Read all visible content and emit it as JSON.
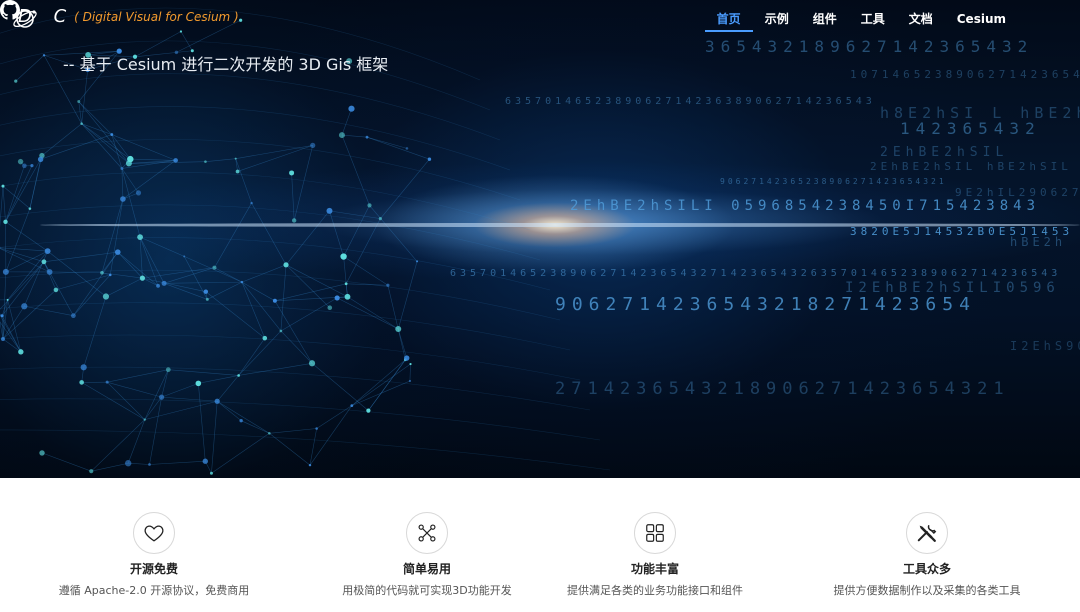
{
  "logo": {
    "text": "D C",
    "subtitle": "( Digital Visual for Cesium )"
  },
  "nav": {
    "items": [
      {
        "label": "首页",
        "active": true
      },
      {
        "label": "示例",
        "active": false
      },
      {
        "label": "组件",
        "active": false
      },
      {
        "label": "工具",
        "active": false
      },
      {
        "label": "文档",
        "active": false
      },
      {
        "label": "Cesium",
        "active": false
      }
    ],
    "github_icon": "github-icon",
    "active_color": "#4a9cff"
  },
  "hero": {
    "tagline": "-- 基于 Cesium 进行二次开发的 3D Gis 框架",
    "digit_rows": [
      "365432189627142365432",
      "10714652389062714236543",
      "6357014652389062714236389062714236543",
      "h8E2hSI L hBE2h",
      "142365432",
      "2EhBE2hSIL",
      "2EhBE2hSIL hBE2hSIL",
      "90627142365238906271423654321",
      "9E2hIL290627",
      "2EhBE2hSILI 0596854238450I715423843",
      "3820E5J14532B0E5J1453",
      "hBE2h",
      "6357014652389062714236543271423654326357014652389062714236543",
      "I2EhBE2hSILI0596",
      "9062714236543218271423654",
      "I2EhS90",
      "2714236543218906271423654321"
    ]
  },
  "features": [
    {
      "icon": "heart-icon",
      "title": "开源免费",
      "desc": "遵循 Apache-2.0 开源协议，免费商用"
    },
    {
      "icon": "nodes-icon",
      "title": "简单易用",
      "desc": "用极简的代码就可实现3D功能开发"
    },
    {
      "icon": "grid-icon",
      "title": "功能丰富",
      "desc": "提供满足各类的业务功能接口和组件"
    },
    {
      "icon": "tools-icon",
      "title": "工具众多",
      "desc": "提供方便数据制作以及采集的各类工具"
    }
  ]
}
